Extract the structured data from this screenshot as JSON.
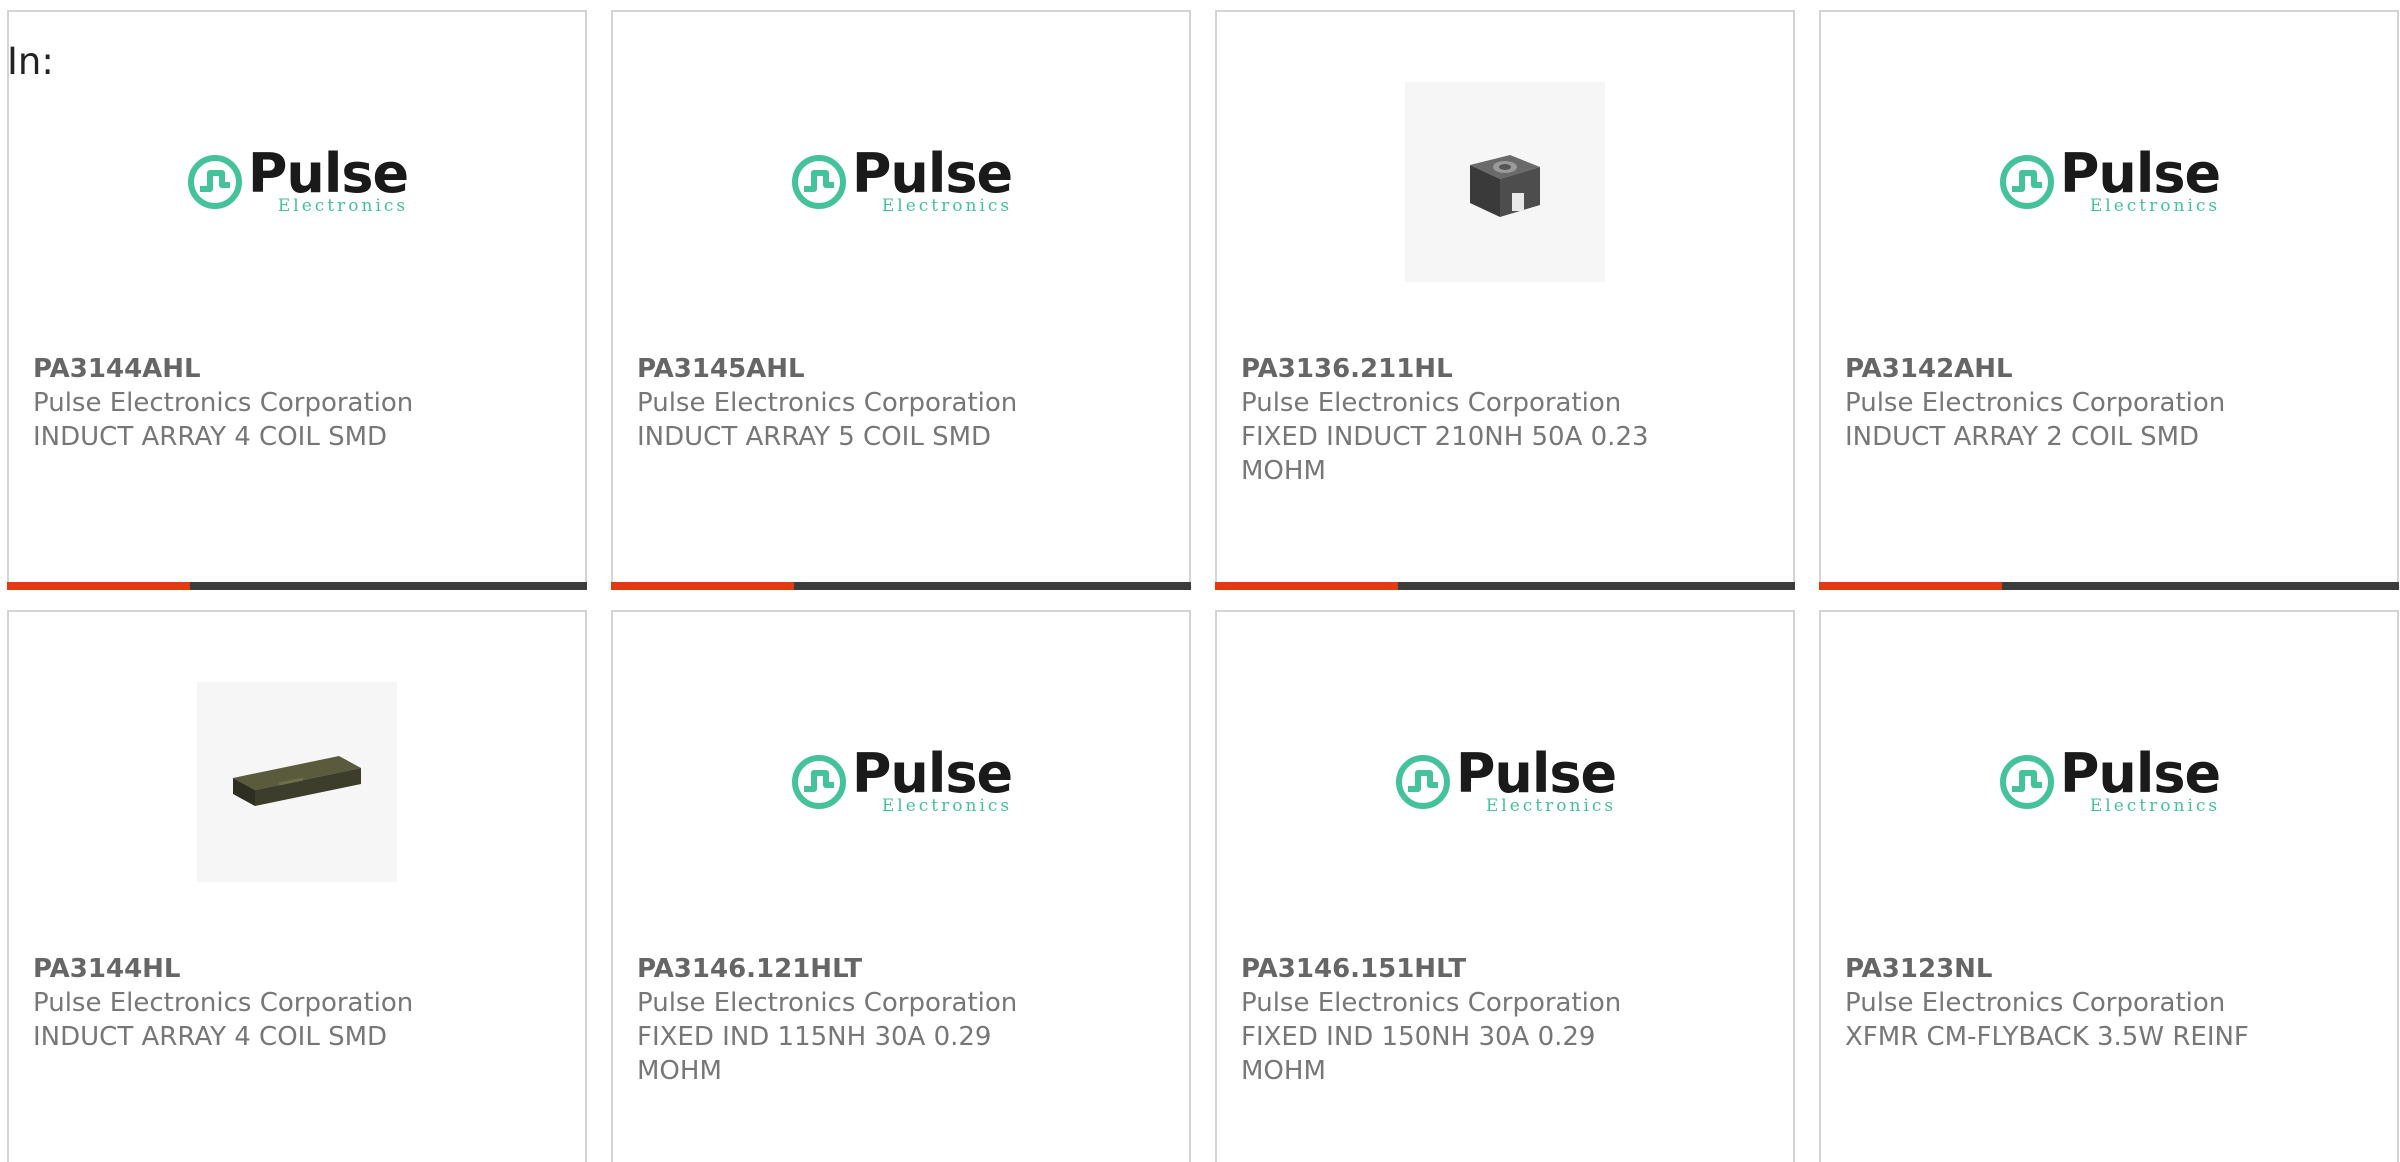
{
  "filter_label": "In:",
  "brand_logo": {
    "word": "Pulse",
    "sub": "Electronics",
    "color": "#43c29b"
  },
  "accent_colors": {
    "bar_accent": "#e03b12",
    "bar_base": "#3c3c3c",
    "card_border": "#d4d4d4"
  },
  "products": [
    {
      "part": "PA3144AHL",
      "manufacturer": "Pulse Electronics Corporation",
      "desc1": "INDUCT ARRAY 4 COIL SMD",
      "desc2": "",
      "image": "pulse-logo"
    },
    {
      "part": "PA3145AHL",
      "manufacturer": "Pulse Electronics Corporation",
      "desc1": "INDUCT ARRAY 5 COIL SMD",
      "desc2": "",
      "image": "pulse-logo"
    },
    {
      "part": "PA3136.211HL",
      "manufacturer": "Pulse Electronics Corporation",
      "desc1": "FIXED INDUCT 210NH 50A 0.23",
      "desc2": "MOHM",
      "image": "smd-inductor-photo"
    },
    {
      "part": "PA3142AHL",
      "manufacturer": "Pulse Electronics Corporation",
      "desc1": "INDUCT ARRAY 2 COIL SMD",
      "desc2": "",
      "image": "pulse-logo"
    },
    {
      "part": "PA3144HL",
      "manufacturer": "Pulse Electronics Corporation",
      "desc1": "INDUCT ARRAY 4 COIL SMD",
      "desc2": "",
      "image": "inductor-array-photo"
    },
    {
      "part": "PA3146.121HLT",
      "manufacturer": "Pulse Electronics Corporation",
      "desc1": "FIXED IND 115NH 30A 0.29",
      "desc2": "MOHM",
      "image": "pulse-logo"
    },
    {
      "part": "PA3146.151HLT",
      "manufacturer": "Pulse Electronics Corporation",
      "desc1": "FIXED IND 150NH 30A 0.29",
      "desc2": "MOHM",
      "image": "pulse-logo"
    },
    {
      "part": "PA3123NL",
      "manufacturer": "Pulse Electronics Corporation",
      "desc1": "XFMR CM-FLYBACK 3.5W REINF",
      "desc2": "",
      "image": "pulse-logo"
    }
  ]
}
